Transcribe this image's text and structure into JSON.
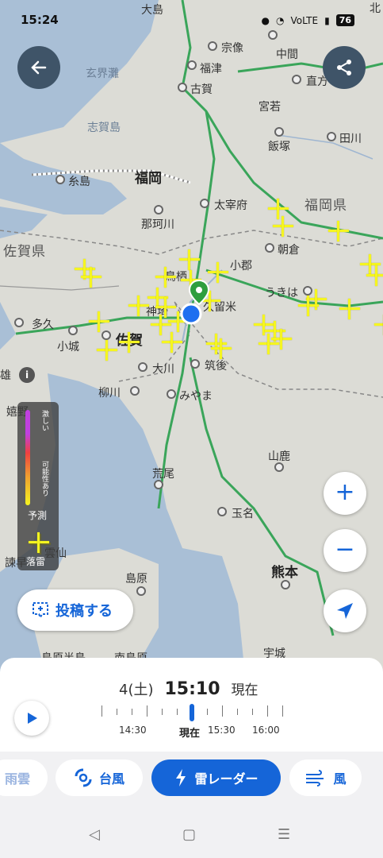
{
  "status_bar": {
    "time": "15:24",
    "signal": "VoLTE",
    "battery": "76"
  },
  "map": {
    "sea_labels": [
      "玄界灘",
      "志賀島"
    ],
    "prefecture_labels": [
      "福岡県",
      "佐賀県"
    ],
    "cities": [
      {
        "name": "大島",
        "big": false
      },
      {
        "name": "宗像",
        "big": false
      },
      {
        "name": "福津",
        "big": false
      },
      {
        "name": "古賀",
        "big": false
      },
      {
        "name": "中間",
        "big": false
      },
      {
        "name": "直方",
        "big": false
      },
      {
        "name": "宮若",
        "big": false
      },
      {
        "name": "飯塚",
        "big": false
      },
      {
        "name": "田川",
        "big": false
      },
      {
        "name": "福岡",
        "big": true
      },
      {
        "name": "糸島",
        "big": false
      },
      {
        "name": "太宰府",
        "big": false
      },
      {
        "name": "那珂川",
        "big": false
      },
      {
        "name": "朝倉",
        "big": false
      },
      {
        "name": "小郡",
        "big": false
      },
      {
        "name": "鳥栖",
        "big": false
      },
      {
        "name": "うきは",
        "big": false
      },
      {
        "name": "神埼",
        "big": false
      },
      {
        "name": "久留米",
        "big": false
      },
      {
        "name": "多久",
        "big": false
      },
      {
        "name": "小城",
        "big": false
      },
      {
        "name": "佐賀",
        "big": true
      },
      {
        "name": "大川",
        "big": false
      },
      {
        "name": "筑後",
        "big": false
      },
      {
        "name": "柳川",
        "big": false
      },
      {
        "name": "みやま",
        "big": false
      },
      {
        "name": "嬉野",
        "big": false
      },
      {
        "name": "雄",
        "big": false
      },
      {
        "name": "山鹿",
        "big": false
      },
      {
        "name": "荒尾",
        "big": false
      },
      {
        "name": "玉名",
        "big": false
      },
      {
        "name": "熊本",
        "big": true
      },
      {
        "name": "諫早",
        "big": false
      },
      {
        "name": "雲仙",
        "big": false
      },
      {
        "name": "島原",
        "big": false
      },
      {
        "name": "宇城",
        "big": false
      },
      {
        "name": "北",
        "big": false
      },
      {
        "name": "島原半島",
        "big": false
      },
      {
        "name": "南島原",
        "big": false
      }
    ]
  },
  "legend": {
    "strong": "激しい",
    "possible": "可能性あり",
    "forecast": "予測",
    "lightning": "落雷"
  },
  "buttons": {
    "post": "投稿する",
    "zoom_in": "+",
    "zoom_out": "−",
    "info": "i"
  },
  "timeline": {
    "date": "4(土)",
    "time": "15:10",
    "status": "現在",
    "labels": [
      "14:30",
      "現在",
      "15:30",
      "16:00"
    ],
    "position_fraction": 0.5
  },
  "chips": [
    {
      "label": "雨雲",
      "icon": "rain-cloud-icon"
    },
    {
      "label": "台風",
      "icon": "typhoon-icon"
    },
    {
      "label": "雷レーダー",
      "icon": "lightning-icon"
    },
    {
      "label": "風",
      "icon": "wind-icon"
    }
  ],
  "colors": {
    "accent": "#1565d8",
    "lightning": "#f5f520",
    "location": "#1e6ff0",
    "pin": "#2e9e3e"
  }
}
